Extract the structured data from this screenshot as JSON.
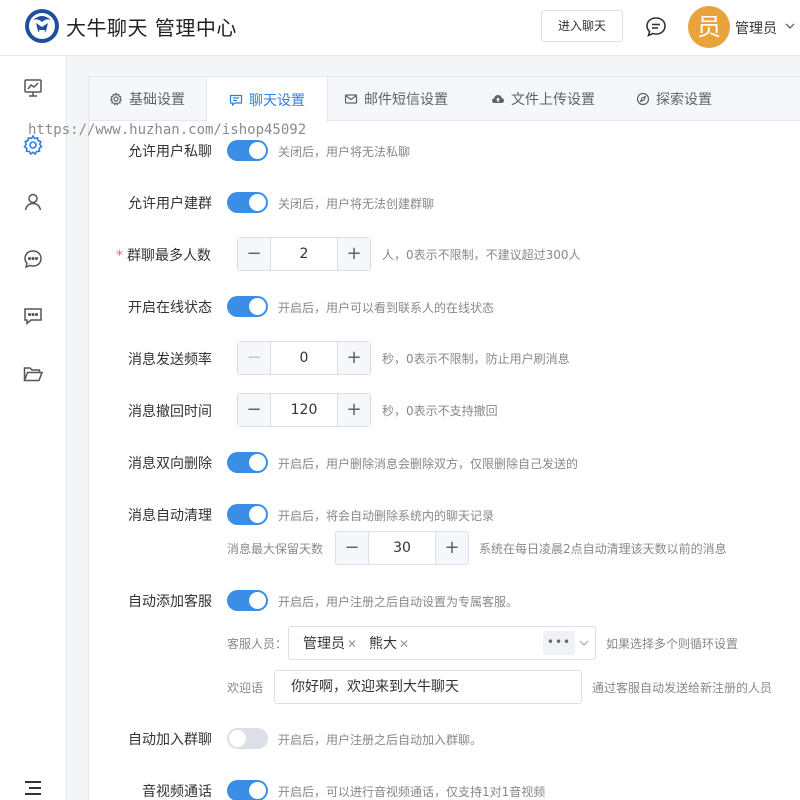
{
  "header": {
    "title": "大牛聊天 管理中心",
    "enter_chat": "进入聊天",
    "avatar_char": "员",
    "user_name": "管理员"
  },
  "sidebar": {
    "items": [
      {
        "icon": "presentation-chart-icon",
        "active": false
      },
      {
        "icon": "gear-icon",
        "active": true
      },
      {
        "icon": "user-icon",
        "active": false
      },
      {
        "icon": "chat-bubble-icon",
        "active": false
      },
      {
        "icon": "message-square-icon",
        "active": false
      },
      {
        "icon": "folder-open-icon",
        "active": false
      }
    ]
  },
  "tabs": [
    {
      "label": "基础设置",
      "icon": "gear-icon",
      "active": false
    },
    {
      "label": "聊天设置",
      "icon": "message-icon",
      "active": true
    },
    {
      "label": "邮件短信设置",
      "icon": "mail-icon",
      "active": false
    },
    {
      "label": "文件上传设置",
      "icon": "cloud-upload-icon",
      "active": false
    },
    {
      "label": "探索设置",
      "icon": "compass-icon",
      "active": false
    }
  ],
  "watermark": "https://www.huzhan.com/ishop45092",
  "settings": {
    "private_chat": {
      "label": "允许用户私聊",
      "enabled": true,
      "hint": "关闭后，用户将无法私聊"
    },
    "create_group": {
      "label": "允许用户建群",
      "enabled": true,
      "hint": "关闭后，用户将无法创建群聊"
    },
    "group_max": {
      "label": "群聊最多人数",
      "required": "*",
      "value": "2",
      "minus": "−",
      "plus": "+",
      "hint": "人，0表示不限制，不建议超过300人"
    },
    "online_status": {
      "label": "开启在线状态",
      "enabled": true,
      "hint": "开启后，用户可以看到联系人的在线状态"
    },
    "send_rate": {
      "label": "消息发送频率",
      "value": "0",
      "minus": "−",
      "plus": "+",
      "minus_disabled": true,
      "hint": "秒，0表示不限制，防止用户刷消息"
    },
    "recall_time": {
      "label": "消息撤回时间",
      "value": "120",
      "minus": "−",
      "plus": "+",
      "hint": "秒，0表示不支持撤回"
    },
    "two_way_delete": {
      "label": "消息双向删除",
      "enabled": true,
      "hint": "开启后，用户删除消息会删除双方，仅限删除自己发送的"
    },
    "auto_clean": {
      "label": "消息自动清理",
      "enabled": true,
      "hint": "开启后，将会自动删除系统内的聊天记录",
      "keep_days_label": "消息最大保留天数",
      "keep_days_value": "30",
      "minus": "−",
      "plus": "+",
      "keep_days_hint": "系统在每日凌晨2点自动清理该天数以前的消息"
    },
    "auto_service": {
      "label": "自动添加客服",
      "enabled": true,
      "hint": "开启后，用户注册之后自动设置为专属客服。",
      "staff_label": "客服人员：",
      "staff_tags": [
        "管理员",
        "熊大"
      ],
      "staff_more": "•••",
      "staff_hint": "如果选择多个则循环设置",
      "welcome_label": "欢迎语",
      "welcome_value": "你好啊，欢迎来到大牛聊天",
      "welcome_hint": "通过客服自动发送给新注册的人员"
    },
    "auto_join_group": {
      "label": "自动加入群聊",
      "enabled": false,
      "hint": "开启后，用户注册之后自动加入群聊。"
    },
    "av_call": {
      "label": "音视频通话",
      "enabled": true,
      "hint": "开启后，可以进行音视频通话，仅支持1对1音视频"
    }
  },
  "colors": {
    "accent": "#3a8ee6",
    "avatar": "#e8a33d",
    "required": "#f56c6c"
  }
}
